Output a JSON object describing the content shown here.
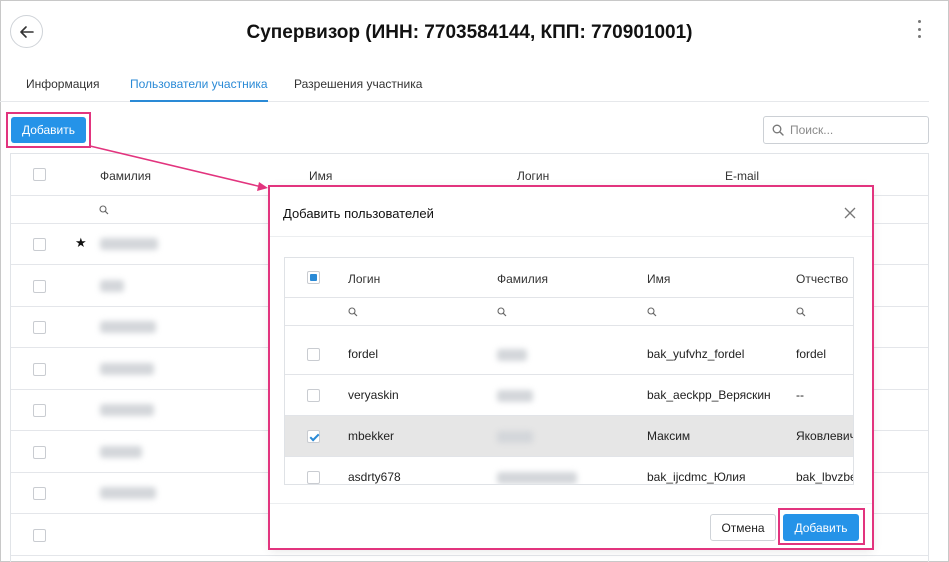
{
  "header": {
    "title": "Супервизор (ИНН: 7703584144, КПП: 770901001)"
  },
  "tabs": [
    {
      "label": "Информация",
      "active": false
    },
    {
      "label": "Пользователи участника",
      "active": true
    },
    {
      "label": "Разрешения участника",
      "active": false
    }
  ],
  "toolbar": {
    "add_label": "Добавить",
    "search_placeholder": "Поиск..."
  },
  "grid": {
    "columns": [
      "Фамилия",
      "Имя",
      "Логин",
      "E-mail"
    ],
    "row_count": 8,
    "favorite_row": 0
  },
  "modal": {
    "title": "Добавить пользователей",
    "columns": [
      "Логин",
      "Фамилия",
      "Имя",
      "Отчество"
    ],
    "rows": [
      {
        "login": "fordel",
        "name": "bak_yufvhz_fordel",
        "patronymic": "fordel",
        "checked": false
      },
      {
        "login": "veryaskin",
        "name": "bak_aeckpp_Веряскин",
        "patronymic": "--",
        "checked": false
      },
      {
        "login": "mbekker",
        "name": "Максим",
        "patronymic": "Яковлевич",
        "checked": true
      },
      {
        "login": "asdrty678",
        "name": "bak_ijcdmc_Юлия",
        "patronymic": "bak_lbvzbe",
        "checked": false
      }
    ],
    "cancel_label": "Отмена",
    "submit_label": "Добавить"
  },
  "colors": {
    "accent": "#2593e8",
    "highlight": "#e2347e"
  }
}
